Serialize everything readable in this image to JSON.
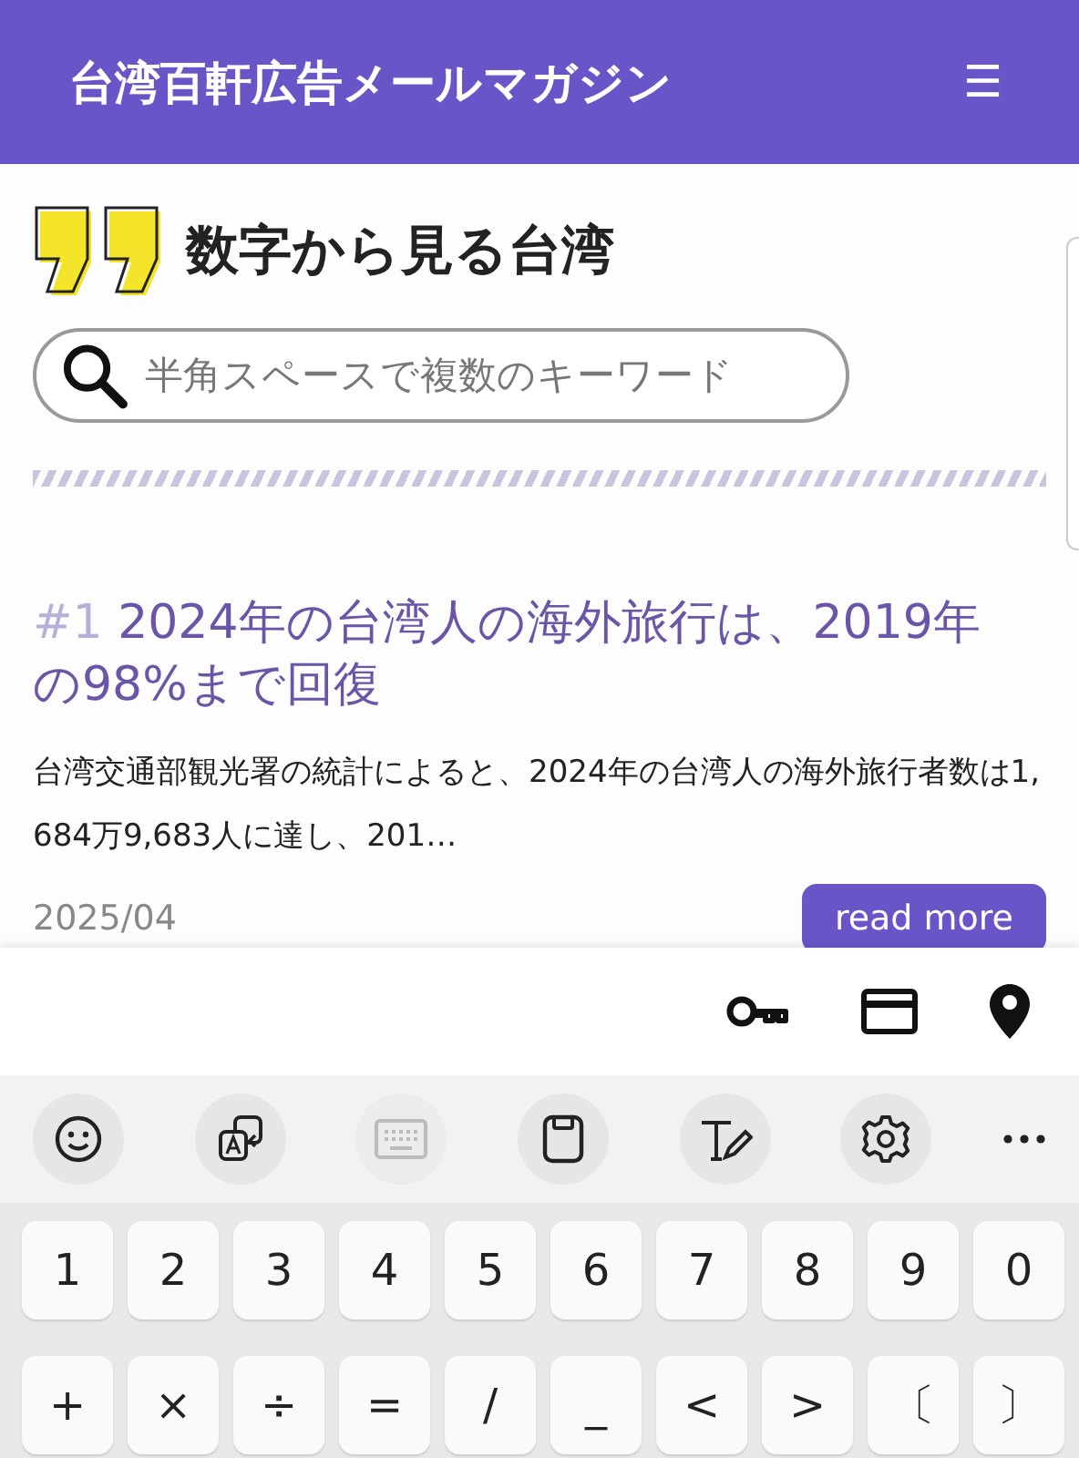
{
  "header": {
    "title": "台湾百軒広告メールマガジン",
    "menu_icon": "☰"
  },
  "section": {
    "title": "数字から見る台湾"
  },
  "search": {
    "placeholder": "半角スペースで複数のキーワード"
  },
  "article": {
    "rank": "#1",
    "title": "2024年の台湾人の海外旅行は、2019年の98%まで回復",
    "excerpt": "台湾交通部観光署の統計によると、2024年の台湾人の海外旅行者数は1,684万9,683人に達し、201…",
    "date": "2025/04",
    "button": "read more"
  },
  "autofill": [
    {
      "kind": "key"
    },
    {
      "kind": "card"
    },
    {
      "kind": "pin"
    }
  ],
  "toolbar": [
    {
      "kind": "emoji",
      "disabled": false
    },
    {
      "kind": "translate",
      "disabled": false
    },
    {
      "kind": "keyboard",
      "disabled": true
    },
    {
      "kind": "clipboard",
      "disabled": false
    },
    {
      "kind": "handwriting",
      "disabled": false
    },
    {
      "kind": "settings",
      "disabled": false
    },
    {
      "kind": "more",
      "disabled": false
    }
  ],
  "key_rows": [
    [
      "1",
      "2",
      "3",
      "4",
      "5",
      "6",
      "7",
      "8",
      "9",
      "0"
    ],
    [
      "+",
      "×",
      "÷",
      "=",
      "/",
      "_",
      "<",
      ">",
      "〔",
      "〕"
    ]
  ]
}
